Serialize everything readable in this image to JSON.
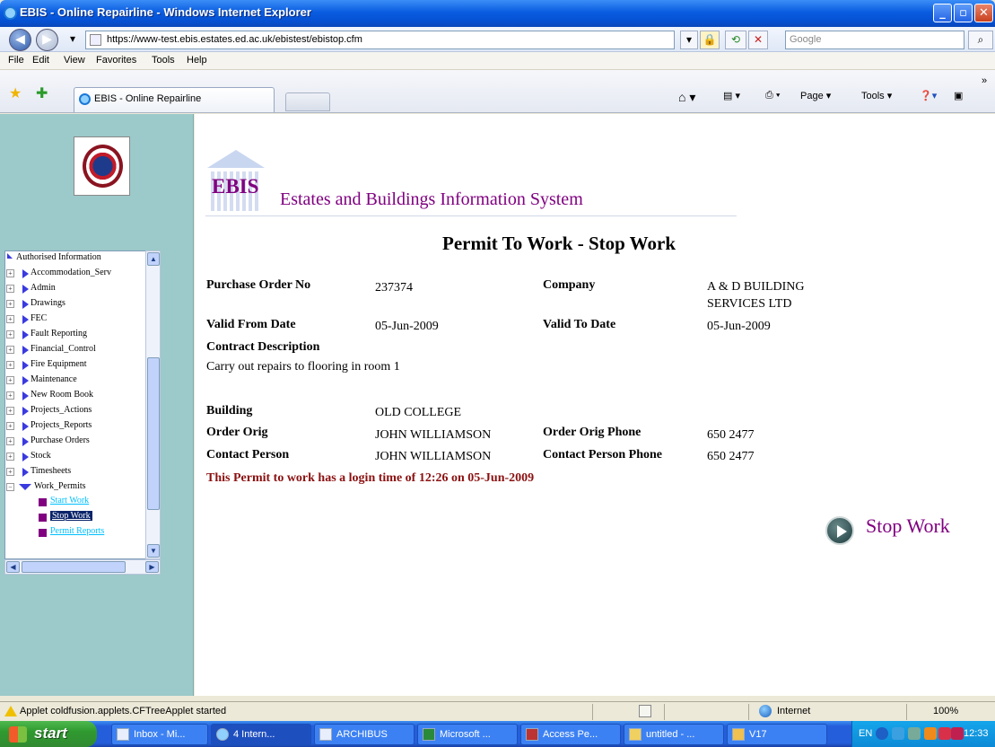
{
  "window": {
    "title": "EBIS - Online Repairline - Windows Internet Explorer",
    "url": "https://www-test.ebis.estates.ed.ac.uk/ebistest/ebistop.cfm",
    "search_placeholder": "Google"
  },
  "menu": [
    "File",
    "Edit",
    "View",
    "Favorites",
    "Tools",
    "Help"
  ],
  "tab": {
    "title": "EBIS - Online Repairline"
  },
  "commands": {
    "page": "Page ▾",
    "tools": "Tools ▾"
  },
  "sidebar": {
    "tree_root": "Authorised Information",
    "items": [
      "Accommodation_Serv",
      "Admin",
      "Drawings",
      "FEC",
      "Fault Reporting",
      "Financial_Control",
      "Fire Equipment",
      "Maintenance",
      "New Room Book",
      "Projects_Actions",
      "Projects_Reports",
      "Purchase Orders",
      "Stock",
      "Timesheets",
      "Work_Permits"
    ],
    "permit_items": [
      "Start Work",
      "Stop Work",
      "Permit Reports"
    ]
  },
  "header": {
    "ebis": "EBIS",
    "system_name": "Estates and Buildings Information System"
  },
  "page": {
    "title": "Permit To Work - Stop Work",
    "fields": {
      "purchase_order_label": "Purchase Order No",
      "purchase_order_value": "237374",
      "company_label": "Company",
      "company_value_line1": "A & D BUILDING",
      "company_value_line2": "SERVICES LTD",
      "valid_from_label": "Valid From Date",
      "valid_from_value": "05-Jun-2009",
      "valid_to_label": "Valid To Date",
      "valid_to_value": "05-Jun-2009",
      "contract_desc_label": "Contract Description",
      "contract_desc_value": "Carry out repairs to flooring in room 1",
      "building_label": "Building",
      "building_value": "OLD COLLEGE",
      "order_orig_label": "Order Orig",
      "order_orig_value": "JOHN WILLIAMSON",
      "order_orig_phone_label": "Order Orig Phone",
      "order_orig_phone_value": "650 2477",
      "contact_person_label": "Contact Person",
      "contact_person_value": "JOHN WILLIAMSON",
      "contact_phone_label": "Contact Person Phone",
      "contact_phone_value": "650 2477"
    },
    "login_note": "This Permit to work has a login time of 12:26 on 05-Jun-2009",
    "stop_button": "Stop Work"
  },
  "status": {
    "message": "Applet coldfusion.applets.CFTreeApplet started",
    "zone": "Internet",
    "zoom": "100%"
  },
  "taskbar": {
    "start": "start",
    "tasks": [
      "Inbox - Mi...",
      "4 Intern...",
      "ARCHIBUS",
      "Microsoft ...",
      "Access Pe...",
      "untitled - ...",
      "V17"
    ],
    "lang": "EN",
    "time": "12:33"
  }
}
